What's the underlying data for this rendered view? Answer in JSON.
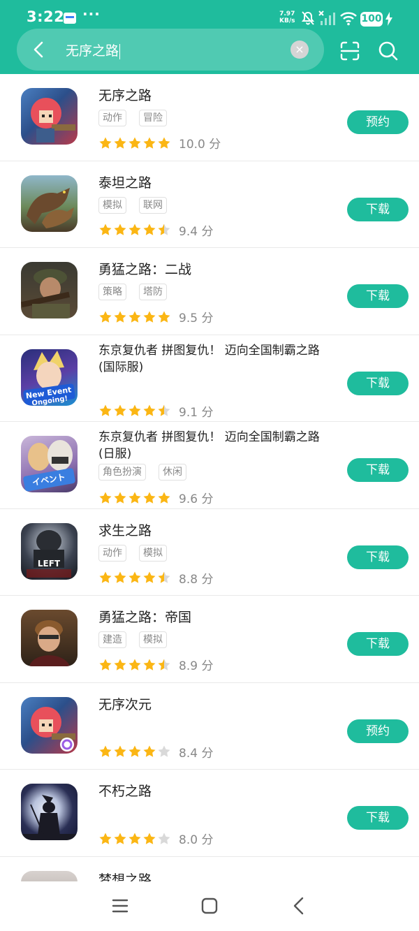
{
  "status": {
    "time": "3:22",
    "speed": "7.97",
    "speed_unit": "KB/s",
    "battery": "100",
    "menu_dots": "···"
  },
  "search": {
    "query": "无序之路",
    "clear_icon": "×",
    "back_icon": "chevron-left-icon",
    "scan_icon": "scan-icon",
    "search_icon": "search-icon"
  },
  "colors": {
    "accent": "#1fbc9d",
    "star": "#fbb614",
    "star_empty": "#d9d9d9"
  },
  "apps": [
    {
      "name": "无序之路",
      "tags": [
        "动作",
        "冒险"
      ],
      "stars": 5,
      "score": "10.0 分",
      "button": "预约"
    },
    {
      "name": "泰坦之路",
      "tags": [
        "模拟",
        "联网"
      ],
      "stars": 4.5,
      "score": "9.4 分",
      "button": "下载"
    },
    {
      "name": "勇猛之路：二战",
      "tags": [
        "策略",
        "塔防"
      ],
      "stars": 5,
      "score": "9.5 分",
      "button": "下载"
    },
    {
      "name_line1": "东京复仇者 拼图复仇！ 迈向全国制霸之路",
      "name_line2": "(国际服)",
      "tags": [],
      "stars": 4.5,
      "score": "9.1 分",
      "button": "下载"
    },
    {
      "name_line1": "东京复仇者 拼图复仇！ 迈向全国制霸之路",
      "name_line2": "(日服)",
      "tags": [
        "角色扮演",
        "休闲"
      ],
      "stars": 5,
      "score": "9.6 分",
      "button": "下载"
    },
    {
      "name": "求生之路",
      "tags": [
        "动作",
        "模拟"
      ],
      "stars": 4.5,
      "score": "8.8 分",
      "button": "下载"
    },
    {
      "name": "勇猛之路：帝国",
      "tags": [
        "建造",
        "模拟"
      ],
      "stars": 4.5,
      "score": "8.9 分",
      "button": "下载"
    },
    {
      "name": "无序次元",
      "tags": [],
      "stars": 4,
      "score": "8.4 分",
      "button": "预约"
    },
    {
      "name": "不朽之路",
      "tags": [],
      "stars": 4,
      "score": "8.0 分",
      "button": "下载"
    },
    {
      "name": "梦想之路",
      "tags": [],
      "stars": 0,
      "score": "",
      "button": ""
    }
  ],
  "nav": {
    "menu_icon": "menu-icon",
    "home_icon": "home-icon",
    "back_icon": "back-icon"
  }
}
